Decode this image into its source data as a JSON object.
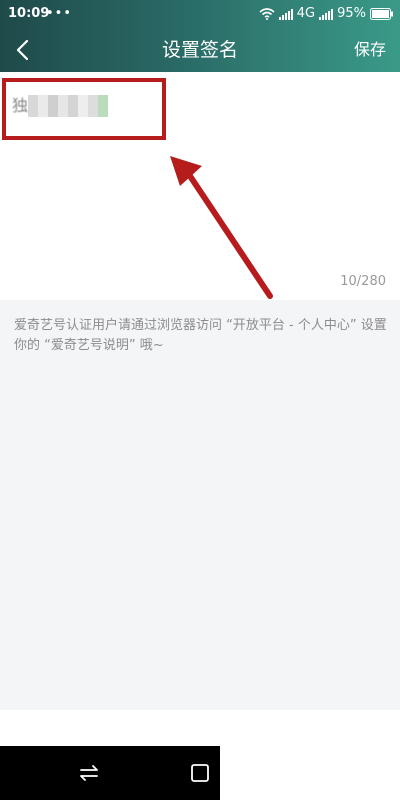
{
  "status_bar": {
    "time": "10:09",
    "dots": "•••",
    "network": "4G",
    "battery": "95%"
  },
  "nav": {
    "title": "设置签名",
    "save_label": "保存",
    "back_icon": "chevron-left-icon"
  },
  "editor": {
    "value_first_char": "独",
    "counter": "10/280"
  },
  "hint": {
    "text": "爱奇艺号认证用户请通过浏览器访问 “开放平台 - 个人中心” 设置你的 “爱奇艺号说明” 哦~"
  },
  "system_nav": {
    "icons": [
      "switch-icon",
      "square-icon"
    ]
  },
  "colors": {
    "header_start": "#1f4a4a",
    "header_end": "#3a9a88",
    "annotation_red": "#b71c1c",
    "hint_bg": "#f4f5f7"
  }
}
